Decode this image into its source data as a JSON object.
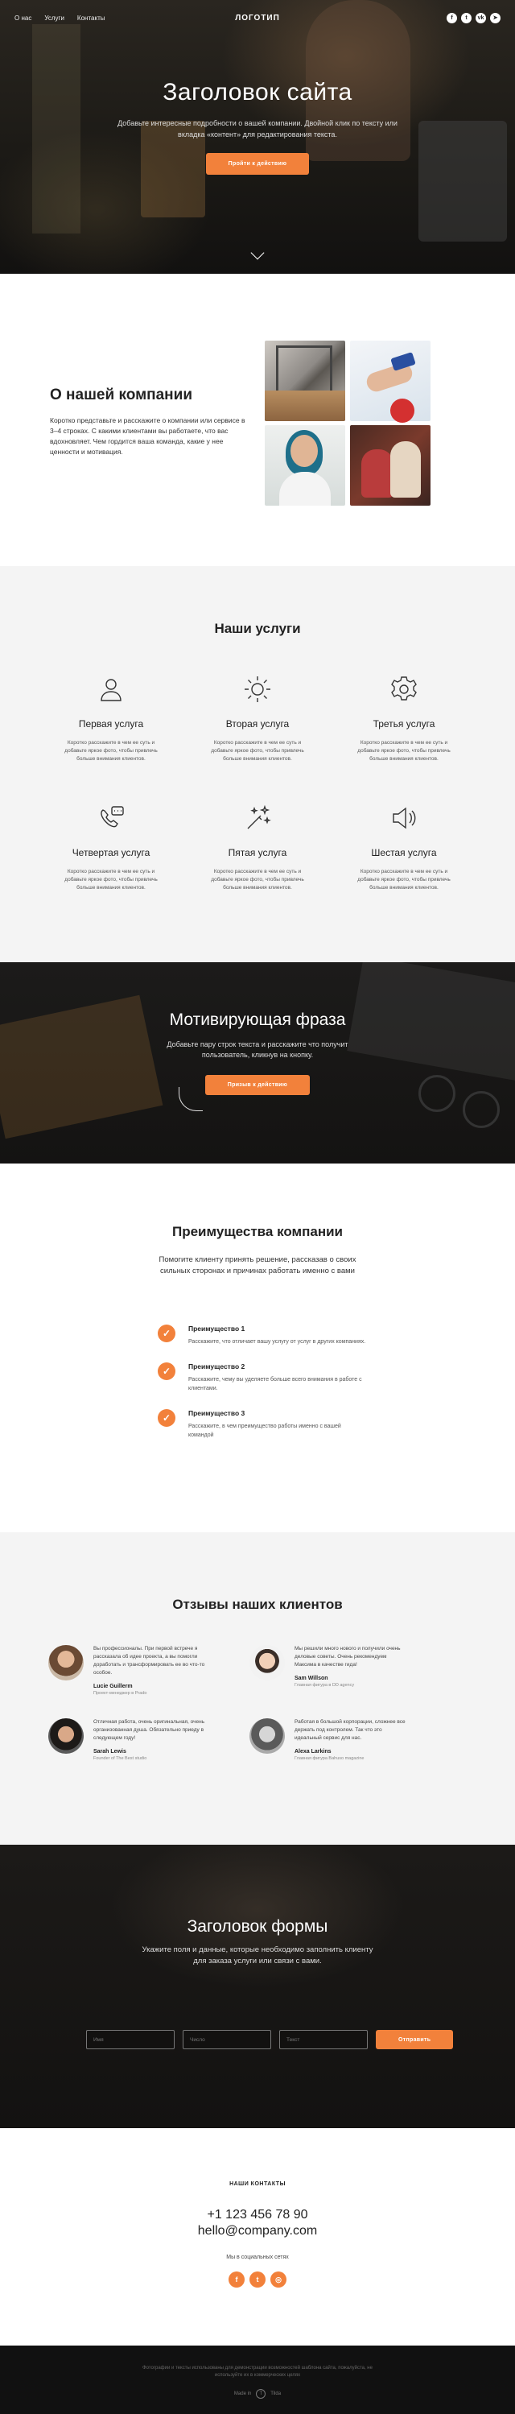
{
  "nav": {
    "links": [
      "О нас",
      "Услуги",
      "Контакты"
    ],
    "logo": "ЛОГОТИП",
    "social_icons": [
      "facebook-icon",
      "twitter-icon",
      "vk-icon",
      "telegram-icon"
    ]
  },
  "hero": {
    "title": "Заголовок сайта",
    "subtitle": "Добавьте интересные подробности о вашей компании. Двойной клик по тексту или вкладка «контент» для редактирования текста.",
    "cta": "Пройти к действию"
  },
  "about": {
    "title": "О нашей компании",
    "body": "Коротко представьте и расскажите о компании или сервисе в 3–4 строках. С какими клиентами вы работаете, что вас вдохновляет. Чем гордится ваша команда, какие у нее ценности и мотивация."
  },
  "services": {
    "title": "Наши услуги",
    "items": [
      {
        "title": "Первая услуга",
        "body": "Коротко расскажите в чем ее суть и добавьте яркое фото, чтобы привлечь больше внимания клиентов.",
        "icon": "person-icon"
      },
      {
        "title": "Вторая услуга",
        "body": "Коротко расскажите в чем ее суть и добавьте яркое фото, чтобы привлечь больше внимания клиентов.",
        "icon": "sun-icon"
      },
      {
        "title": "Третья услуга",
        "body": "Коротко расскажите в чем ее суть и добавьте яркое фото, чтобы привлечь больше внимания клиентов.",
        "icon": "gear-icon"
      },
      {
        "title": "Четвертая услуга",
        "body": "Коротко расскажите в чем ее суть и добавьте яркое фото, чтобы привлечь больше внимания клиентов.",
        "icon": "phone-chat-icon"
      },
      {
        "title": "Пятая услуга",
        "body": "Коротко расскажите в чем ее суть и добавьте яркое фото, чтобы привлечь больше внимания клиентов.",
        "icon": "magic-wand-icon"
      },
      {
        "title": "Шестая услуга",
        "body": "Коротко расскажите в чем ее суть и добавьте яркое фото, чтобы привлечь больше внимания клиентов.",
        "icon": "speaker-icon"
      }
    ]
  },
  "motivation": {
    "title": "Мотивирующая фраза",
    "subtitle": "Добавьте пару строк текста и расскажите что получит пользователь, кликнув на кнопку.",
    "cta": "Призыв к действию"
  },
  "advantages": {
    "title": "Преимущества компании",
    "subtitle": "Помогите клиенту принять решение, рассказав о своих сильных сторонах и причинах работать именно с вами",
    "items": [
      {
        "title": "Преимущество 1",
        "body": "Расскажите, что отличает вашу услугу от услуг в других компаниях."
      },
      {
        "title": "Преимущество 2",
        "body": "Расскажите, чему вы уделяете больше всего внимания в работе с клиентами."
      },
      {
        "title": "Преимущество 3",
        "body": "Расскажите, в чем преимущество работы именно с вашей командой"
      }
    ]
  },
  "reviews": {
    "title": "Отзывы наших клиентов",
    "items": [
      {
        "text": "Вы профессионалы. При первой встрече я рассказала об идее проекта, а вы помогли доработать и трансформировать ее во что-то особое.",
        "name": "Lucie Guillerm",
        "role": "Проект-менеджер в",
        "company": "Prado"
      },
      {
        "text": "Мы решили много нового и получили очень деловые советы. Очень рекомендуем Максима в качестве гида!",
        "name": "Sam Willson",
        "role": "Главная фигура в",
        "company": "DD agency"
      },
      {
        "text": "Отличная работа, очень оригинальная, очень организованная душа. Обязательно приеду в следующем году!",
        "name": "Sarah Lewis",
        "role": "Founder of",
        "company": "The Best studio"
      },
      {
        "text": "Работая в большой корпорации, сложнее все держать под контролем. Так что это идеальный сервис для нас.",
        "name": "Alexa Larkins",
        "role": "Главная фигура",
        "company": "Bahuso magazine"
      }
    ]
  },
  "form": {
    "title": "Заголовок формы",
    "subtitle": "Укажите поля и данные, которые необходимо заполнить клиенту для заказа услуги или связи с вами.",
    "fields": [
      "Имя",
      "Число",
      "Текст"
    ],
    "submit": "Отправить"
  },
  "contacts": {
    "heading": "НАШИ КОНТАКТЫ",
    "phone": "+1 123 456 78 90",
    "email": "hello@company.com",
    "social_label": "Мы в социальных сетях",
    "social_icons": [
      "facebook-icon",
      "twitter-icon",
      "instagram-icon"
    ]
  },
  "footer": {
    "note": "Фотографии и тексты использованы для демонстрации возможностей шаблона сайта, пожалуйста, не используйте их в коммерческих целях",
    "made_with": "Made in",
    "brand": "Tilda"
  },
  "colors": {
    "accent": "#f2813b",
    "dark": "#141312",
    "light_bg": "#f4f4f4"
  }
}
